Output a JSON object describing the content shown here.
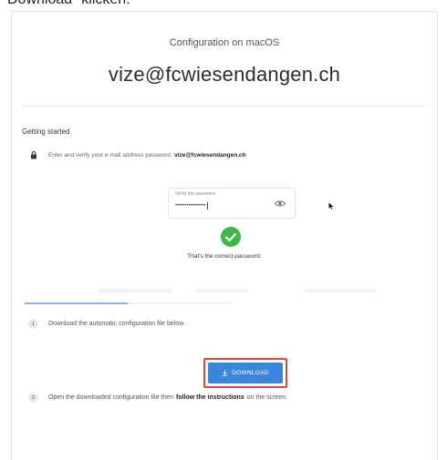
{
  "caption": "Download\" klicken.",
  "header": {
    "title": "Configuration on macOS",
    "email": "vize@fcwiesendangen.ch"
  },
  "getting_started": {
    "title": "Getting started",
    "instruction_prefix": "Enter and verify your e-mail address password",
    "instruction_email": "vize@fcwiesendangen.ch"
  },
  "password_field": {
    "label": "Verify the password",
    "value": "••••••••••••••••"
  },
  "confirmation": {
    "text": "That's the correct password."
  },
  "progress": {
    "value": 0.5
  },
  "steps": [
    {
      "number": "1",
      "text": "Download the automatic configuration file below."
    },
    {
      "number": "2",
      "prefix": "Open the downloaded configuration file then",
      "bold": "follow the instructions",
      "suffix": "on the screen."
    }
  ],
  "download_button": {
    "label": "DOWNLOAD"
  },
  "colors": {
    "accent": "#3a86dd",
    "highlight": "#e04a37",
    "success": "#3fb54a"
  }
}
